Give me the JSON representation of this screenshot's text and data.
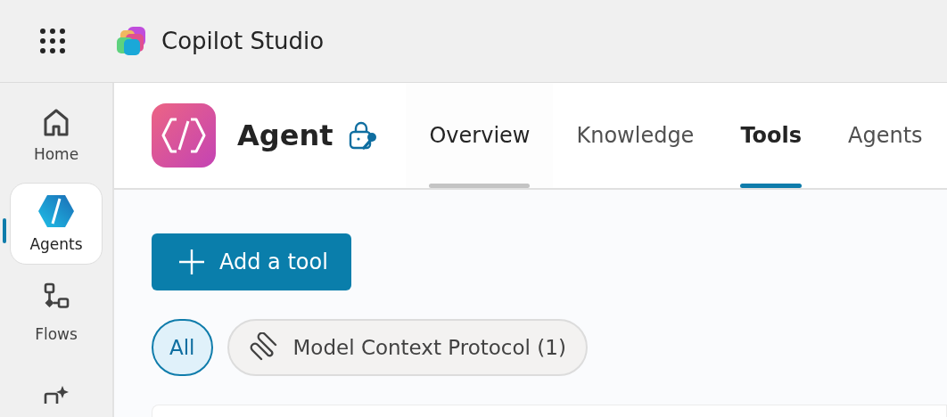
{
  "app": {
    "title": "Copilot Studio"
  },
  "sidebar": {
    "items": [
      {
        "label": "Home",
        "selected": false
      },
      {
        "label": "Agents",
        "selected": true
      },
      {
        "label": "Flows",
        "selected": false
      },
      {
        "selected": false
      }
    ]
  },
  "agent": {
    "name": "Agent"
  },
  "tabs": [
    {
      "label": "Overview",
      "selected": false,
      "hovered": true
    },
    {
      "label": "Knowledge",
      "selected": false,
      "hovered": false
    },
    {
      "label": "Tools",
      "selected": true,
      "hovered": false
    },
    {
      "label": "Agents",
      "selected": false,
      "hovered": false
    }
  ],
  "add_button": {
    "label": "Add a tool"
  },
  "filters": [
    {
      "label": "All",
      "selected": true
    },
    {
      "label": "Model Context Protocol (1)",
      "selected": false
    }
  ]
}
